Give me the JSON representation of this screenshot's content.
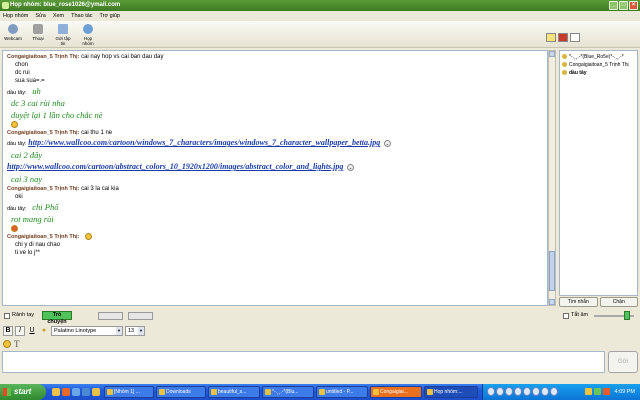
{
  "window": {
    "title": "Họp nhóm: blue_rose1026@ymail.com"
  },
  "menu": [
    "Họp nhóm",
    "Sửa",
    "Xem",
    "Thao tác",
    "Trợ giúp"
  ],
  "toolbar": [
    {
      "label": "Webcam",
      "icon": "webcam-icon"
    },
    {
      "label": "Thoại",
      "icon": "voice-icon"
    },
    {
      "label": "Gửi tập tin",
      "icon": "send-file-icon"
    },
    {
      "label": "Họp nhóm",
      "icon": "conference-icon"
    }
  ],
  "chat": [
    {
      "sender": "Congaigiaitoan_5 Trịnh Thị:",
      "text": "cai nay hop vs cai ban dau day"
    },
    {
      "line": "chon"
    },
    {
      "line": "dc rui"
    },
    {
      "line": "sua sua=.="
    },
    {
      "dauthay": "dầu tây:",
      "green": "uh"
    },
    {
      "green": "dc 3 cai rùi nha"
    },
    {
      "green": "duyệt lại 1 lần cho chắc nè"
    },
    {
      "sender": "Congaigiaitoan_5 Trịnh Thị:",
      "text": "cai thu 1 ne"
    },
    {
      "dauthay": "dầu tây:",
      "link": "http://www.wallcoo.com/cartoon/windows_7_characters/images/windows_7_character_wallpaper_betta.jpg"
    },
    {
      "green": "cai 2 đây"
    },
    {
      "link": "http://www.wallcoo.com/cartoon/abstract_colors_10_1920x1200/images/abstract_color_and_lights.jpg"
    },
    {
      "green": "cai 3 nay"
    },
    {
      "sender": "Congaigiaitoan_5 Trịnh Thị:",
      "text": "cai 3 la cai kia"
    },
    {
      "line": "oki"
    },
    {
      "dauthay": "dầu tây:",
      "green": "chi Phố"
    },
    {
      "green": "rot mang rùi"
    },
    {
      "sender": "Congaigiaitoan_5 Trịnh Thị:",
      "text": ""
    },
    {
      "line": "chi y di nau chao"
    },
    {
      "line": "ti ve lo j**"
    }
  ],
  "participants": [
    {
      "name": "*-.¸¸.-*(Blue_Ro5e)*-.¸¸.-*",
      "bold": false
    },
    {
      "name": "Congaigiaitoan_5 Trịnh Thị",
      "bold": false
    },
    {
      "name": "dầu tây",
      "bold": true
    }
  ],
  "participant_buttons": {
    "invite": "Tìm nhắn",
    "block": "Chặn"
  },
  "options": {
    "ranh_tay": "Rảnh tay",
    "tro_chuyen": "Trò chuyện",
    "tat_am": "Tắt âm"
  },
  "format": {
    "bold": "B",
    "italic": "I",
    "underline": "U",
    "font": "Palatino Linotype",
    "size": "13"
  },
  "input": {
    "value": "",
    "send_label": "Gửi"
  },
  "taskbar": {
    "start": "start",
    "tasks": [
      "[Nhóm 1] ...",
      "Downloads",
      "beautiful_s...",
      "*-.¸¸.-*(Blu...",
      "untitled - P...",
      "Congaigiai...",
      "Họp nhóm:..."
    ],
    "clock": "4:09 PM"
  }
}
